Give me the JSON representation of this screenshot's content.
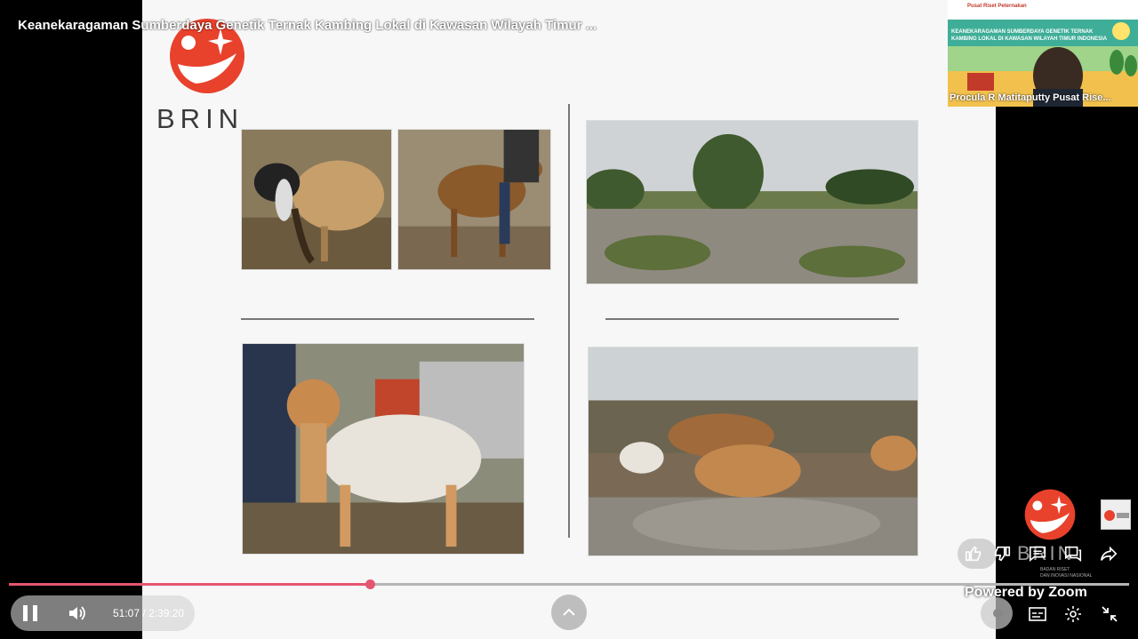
{
  "video": {
    "title": "Keanekaragaman Sumberdaya Genetik Ternak Kambing Lokal di Kawasan Wilayah Timur ...",
    "current_time": "51:07",
    "duration": "2:39:20",
    "time_separator": " / ",
    "progress_fraction": 0.322
  },
  "slide": {
    "logo_text": "BRIN"
  },
  "speaker_thumbnail": {
    "caption": "Procula R Matitaputty  Pusat Rise...",
    "banner_line1": "KEANEKARAGAMAN SUMBERDAYA GENETIK TERNAK",
    "banner_line2": "KAMBING LOKAL DI KAWASAN WILAYAH TIMUR INDONESIA",
    "org_text": "Pusat Riset Peternakan"
  },
  "overlay": {
    "powered_by": "Powered by Zoom",
    "brin_caption": "BRIN",
    "brin_sub1": "BADAN RISET",
    "brin_sub2": "DAN INOVASI NASIONAL"
  },
  "colors": {
    "brin_red": "#e8412c",
    "progress": "#e5556f"
  },
  "icons": [
    "like-icon",
    "dislike-icon",
    "comment-icon",
    "chat-icon",
    "share-icon",
    "pause-icon",
    "volume-icon",
    "chevron-up-icon",
    "captions-icon",
    "settings-icon",
    "minimize-icon"
  ]
}
